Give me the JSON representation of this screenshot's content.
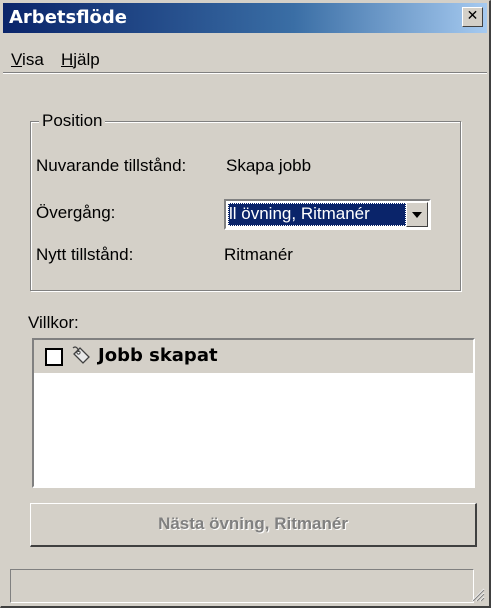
{
  "window": {
    "title": "Arbetsflöde",
    "close_glyph": "✕"
  },
  "menu": {
    "items": [
      {
        "label": "Visa",
        "mnemonic": "V",
        "rest": "isa"
      },
      {
        "label": "Hjälp",
        "mnemonic": "H",
        "rest": "jälp"
      }
    ]
  },
  "position_group": {
    "title": "Position",
    "current_state_label": "Nuvarande tillstånd:",
    "current_state_value": "Skapa jobb",
    "transition_label": "Övergång:",
    "transition_value": "ll övning, Ritmanér",
    "new_state_label": "Nytt tillstånd:",
    "new_state_value": "Ritmanér"
  },
  "conditions": {
    "label": "Villkor:",
    "items": [
      {
        "label": "Jobb skapat",
        "checked": false,
        "icon": "tag-icon"
      }
    ]
  },
  "next_button": {
    "label": "Nästa övning, Ritmanér",
    "enabled": false
  },
  "statusbar": {
    "text": ""
  },
  "colors": {
    "face": "#d4d0c8",
    "title_active": "#0a246a",
    "selection": "#0a246a",
    "disabled_text": "#808080"
  }
}
